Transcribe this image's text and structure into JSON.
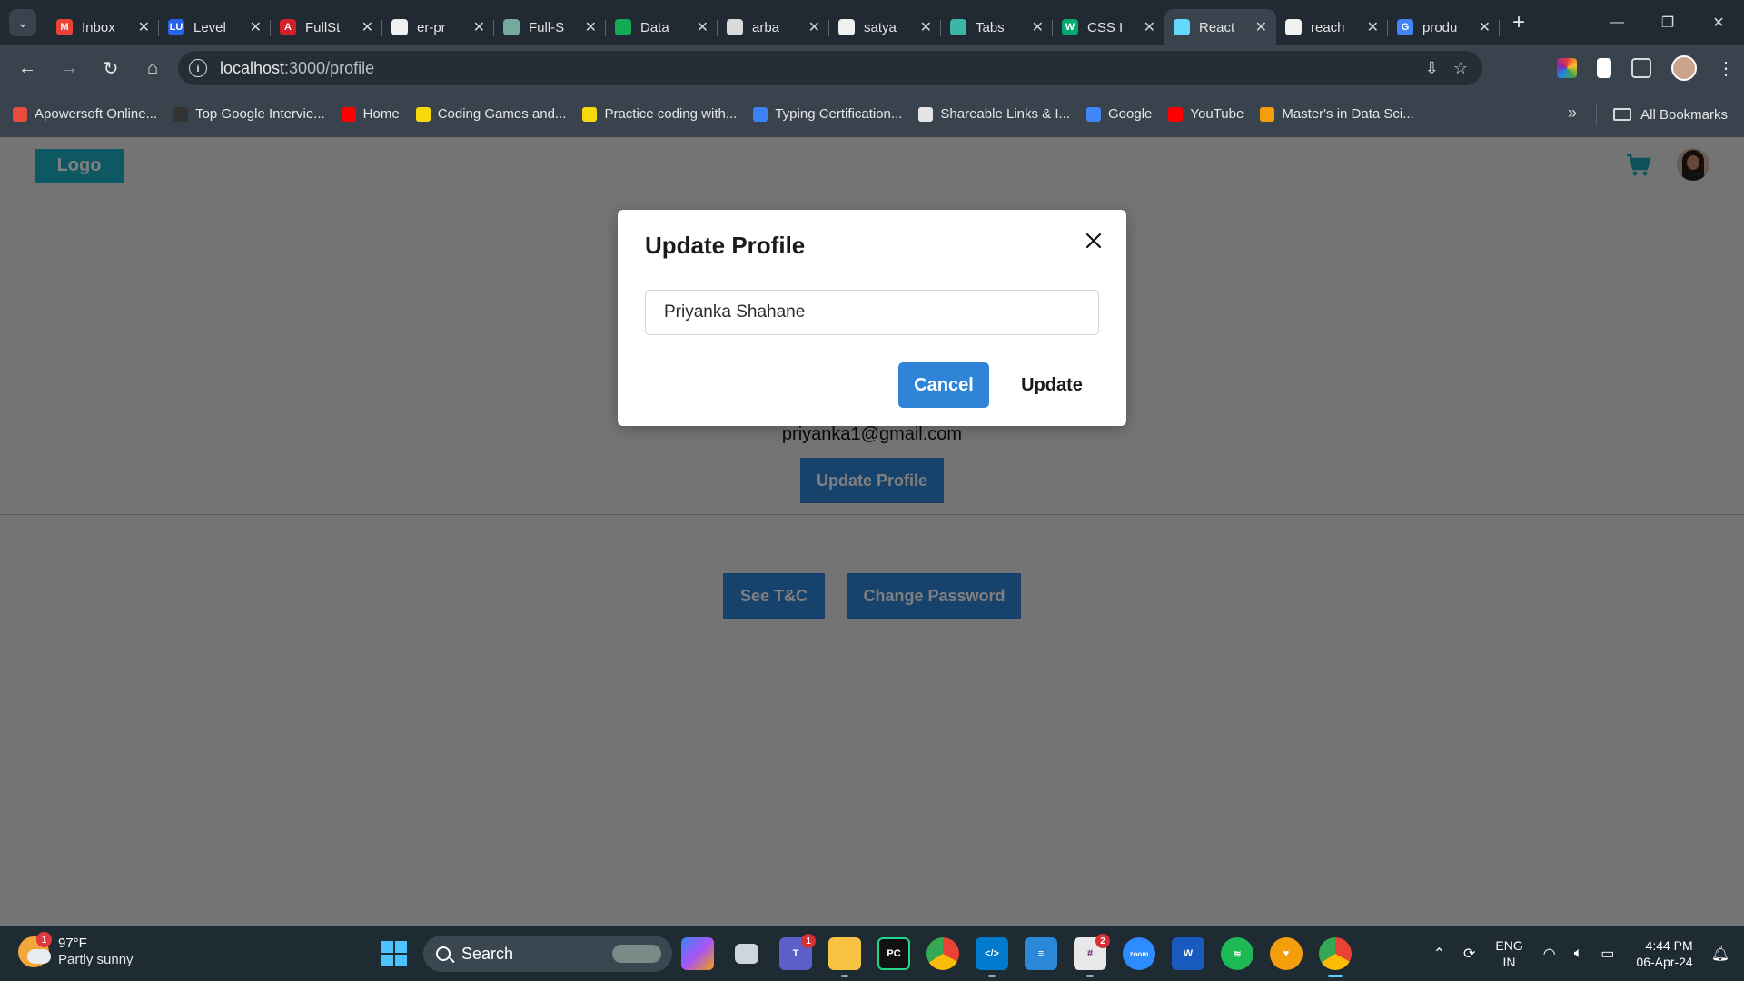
{
  "browser": {
    "tabs": [
      {
        "title": "Inbox",
        "icon": "gmail-icon",
        "color": "#ea4335",
        "glyph": "M"
      },
      {
        "title": "Level",
        "icon": "lu-icon",
        "color": "#2563eb",
        "glyph": "LU"
      },
      {
        "title": "FullSt",
        "icon": "pdf-icon",
        "color": "#d4202a",
        "glyph": "A"
      },
      {
        "title": "er-pr",
        "icon": "github-icon",
        "color": "#f0f0f0",
        "glyph": ""
      },
      {
        "title": "Full-S",
        "icon": "chatgpt-icon",
        "color": "#74aa9c",
        "glyph": ""
      },
      {
        "title": "Data",
        "icon": "mongodb-icon",
        "color": "#13aa52",
        "glyph": ""
      },
      {
        "title": "arba",
        "icon": "link-icon",
        "color": "#d9d9d9",
        "glyph": ""
      },
      {
        "title": "satya",
        "icon": "github-icon",
        "color": "#f0f0f0",
        "glyph": ""
      },
      {
        "title": "Tabs",
        "icon": "bolt-icon",
        "color": "#3bb6a8",
        "glyph": ""
      },
      {
        "title": "CSS I",
        "icon": "w3schools-icon",
        "color": "#04aa6d",
        "glyph": "W"
      },
      {
        "title": "React",
        "icon": "react-icon",
        "color": "#61dafb",
        "glyph": "",
        "active": true
      },
      {
        "title": "reach",
        "icon": "github-icon",
        "color": "#f0f0f0",
        "glyph": ""
      },
      {
        "title": "produ",
        "icon": "google-icon",
        "color": "#4285f4",
        "glyph": "G"
      }
    ],
    "url_host": "localhost",
    "url_path": ":3000/profile",
    "bookmarks": [
      {
        "label": "Apowersoft Online...",
        "color": "#e74c3c"
      },
      {
        "label": "Top Google Intervie...",
        "color": "#333333"
      },
      {
        "label": "Home",
        "color": "#ff0000"
      },
      {
        "label": "Coding Games and...",
        "color": "#f5d90a"
      },
      {
        "label": "Practice coding with...",
        "color": "#f5d90a"
      },
      {
        "label": "Typing Certification...",
        "color": "#3b82f6"
      },
      {
        "label": "Shareable Links & I...",
        "color": "#e5e5e5"
      },
      {
        "label": "Google",
        "color": "#4285f4"
      },
      {
        "label": "YouTube",
        "color": "#ff0000"
      },
      {
        "label": "Master's in Data Sci...",
        "color": "#f59e0b"
      }
    ],
    "all_bookmarks": "All Bookmarks"
  },
  "page": {
    "logo": "Logo",
    "email": "priyanka1@gmail.com",
    "update_profile_button": "Update Profile",
    "see_tc_button": "See T&C",
    "change_password_button": "Change Password",
    "accent_color": "#2f84d8"
  },
  "modal": {
    "title": "Update Profile",
    "name_value": "Priyanka Shahane",
    "cancel_label": "Cancel",
    "update_label": "Update"
  },
  "taskbar": {
    "weather_temp": "97°F",
    "weather_desc": "Partly sunny",
    "weather_badge": "1",
    "search_label": "Search",
    "lang_top": "ENG",
    "lang_bottom": "IN",
    "time": "4:44 PM",
    "date": "06-Apr-24",
    "teams_badge": "1",
    "slack_badge": "2"
  }
}
